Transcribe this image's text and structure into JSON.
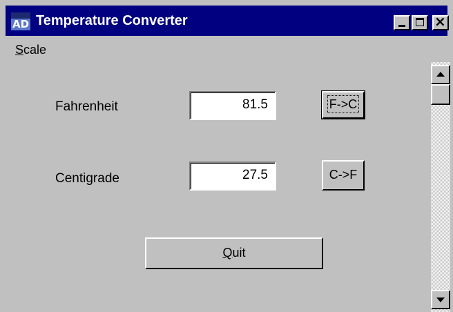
{
  "window": {
    "title": "Temperature Converter",
    "app_icon_text": "AD"
  },
  "menu": {
    "scale_first": "S",
    "scale_rest": "cale"
  },
  "fahrenheit": {
    "label": "Fahrenheit",
    "value": "81.5",
    "button": "F->C"
  },
  "centigrade": {
    "label": "Centigrade",
    "value": "27.5",
    "button": "C->F"
  },
  "quit": {
    "first": "Q",
    "rest": "uit"
  },
  "colors": {
    "titlebar": "#000080",
    "face": "#c0c0c0",
    "field": "#ffffff"
  }
}
